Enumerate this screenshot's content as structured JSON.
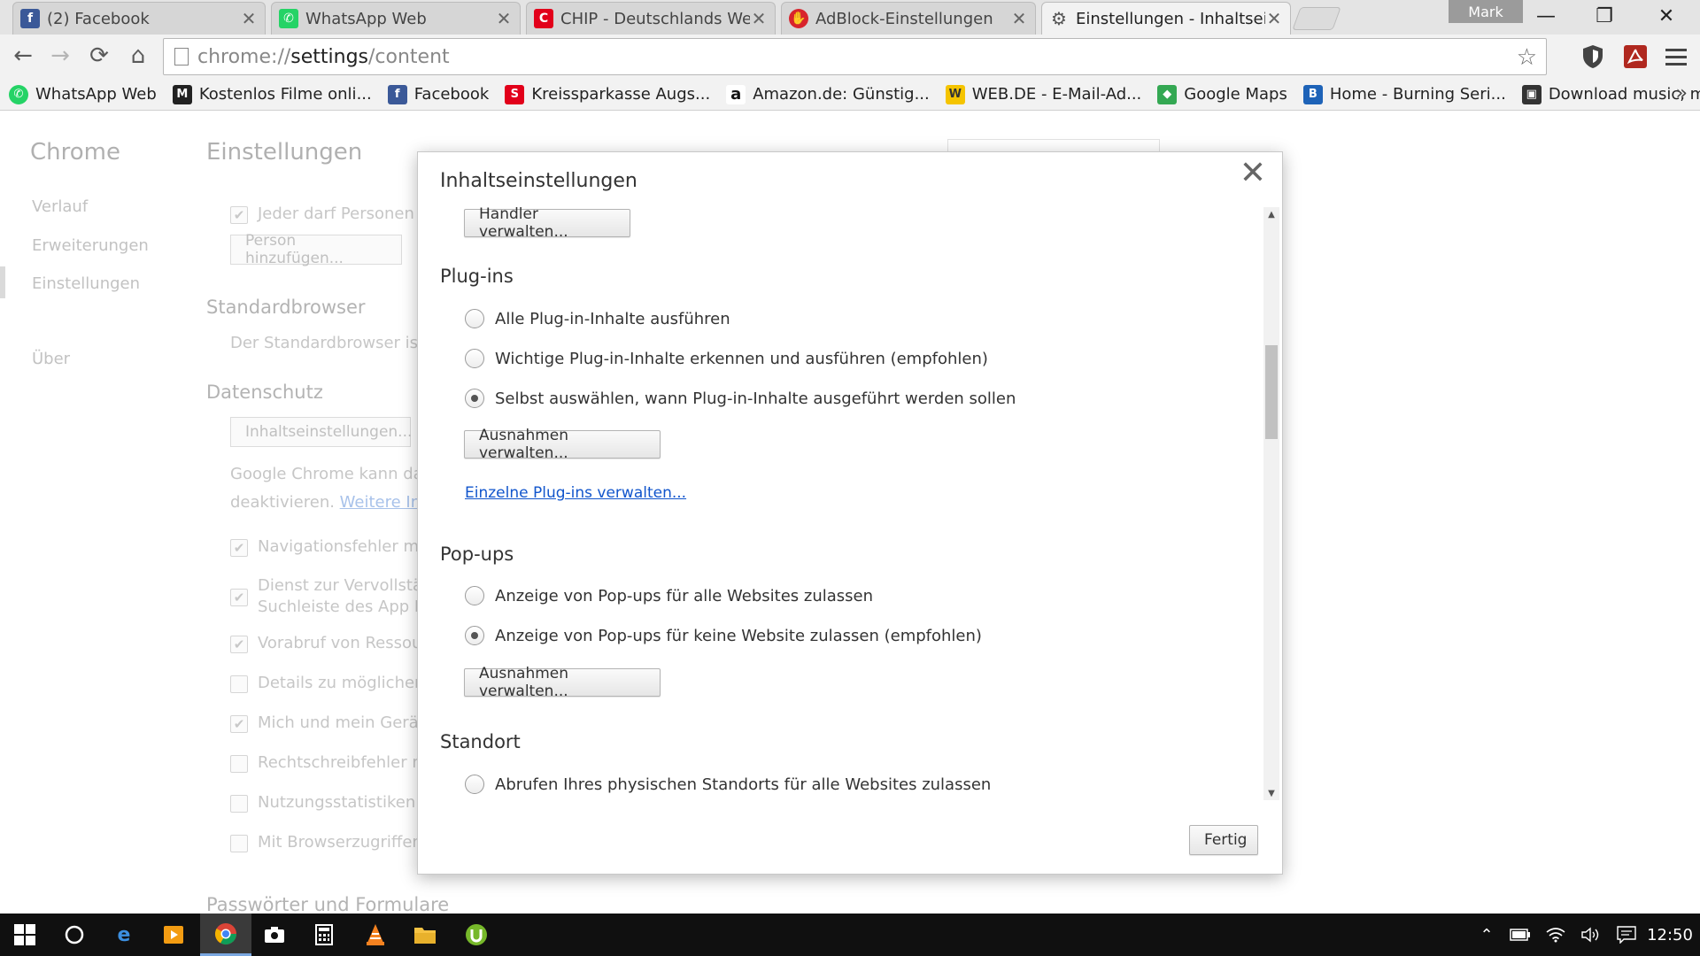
{
  "tabs": [
    {
      "title": "(2) Facebook",
      "icon": "facebook-icon",
      "color": "#3b5998",
      "glyph": "f"
    },
    {
      "title": "WhatsApp Web",
      "icon": "whatsapp-icon",
      "color": "#25d366",
      "glyph": "✆"
    },
    {
      "title": "CHIP - Deutschlands Webs",
      "icon": "chip-icon",
      "color": "#e2001a",
      "glyph": "C"
    },
    {
      "title": "AdBlock-Einstellungen",
      "icon": "adblock-icon",
      "color": "#d8242c",
      "glyph": "✋"
    },
    {
      "title": "Einstellungen - Inhaltseins",
      "icon": "gear-icon",
      "color": "#666666",
      "glyph": "⚙"
    }
  ],
  "profile": "Mark",
  "window_controls": {
    "minimize": "—",
    "restore": "❐",
    "close": "✕"
  },
  "toolbar": {
    "back": "←",
    "forward": "→",
    "reload": "⟳",
    "home": "⌂",
    "url_scheme": "chrome://",
    "url_host": "settings",
    "url_path": "/content",
    "star": "☆"
  },
  "bookmarks": [
    {
      "label": "WhatsApp Web",
      "icon": "whatsapp-icon",
      "color": "#25d366",
      "glyph": "✆"
    },
    {
      "label": "Kostenlos Filme onli...",
      "icon": "m-icon",
      "color": "#222222",
      "glyph": "M"
    },
    {
      "label": "Facebook",
      "icon": "facebook-icon",
      "color": "#3b5998",
      "glyph": "f"
    },
    {
      "label": "Kreissparkasse Augs...",
      "icon": "sparkasse-icon",
      "color": "#e2001a",
      "glyph": "S"
    },
    {
      "label": "Amazon.de: Günstig...",
      "icon": "amazon-icon",
      "color": "#ffffff",
      "glyph": "a"
    },
    {
      "label": "WEB.DE - E-Mail-Ad...",
      "icon": "webde-icon",
      "color": "#f5c400",
      "glyph": "W"
    },
    {
      "label": "Google Maps",
      "icon": "maps-icon",
      "color": "#34a853",
      "glyph": "◆"
    },
    {
      "label": "Home - Burning Seri...",
      "icon": "bs-icon",
      "color": "#1e63b8",
      "glyph": "B"
    },
    {
      "label": "Download music, m...",
      "icon": "download-icon",
      "color": "#333333",
      "glyph": "▣"
    }
  ],
  "bookmarks_more": "»",
  "settings": {
    "brand": "Chrome",
    "nav": [
      "Verlauf",
      "Erweiterungen",
      "Einstellungen",
      "Über"
    ],
    "title": "Einstellungen",
    "people_checkbox": "Jeder darf Personen zu",
    "add_person_button": "Person hinzufügen...",
    "default_browser_head": "Standardbrowser",
    "default_browser_text": "Der Standardbrowser ist m",
    "privacy_head": "Datenschutz",
    "content_settings_button": "Inhaltseinstellungen...",
    "privacy_text_1": "Google Chrome kann das B",
    "privacy_text_2_prefix": "deaktivieren. ",
    "privacy_link": "Weitere Infor",
    "checkboxes": [
      {
        "label": "Navigationsfehler mith",
        "checked": true
      },
      {
        "label": "Dienst zur Vervollständ",
        "label2": "Suchleiste des App Lau",
        "checked": true
      },
      {
        "label": "Vorabruf von Ressourc",
        "checked": true
      },
      {
        "label": "Details zu möglichen s",
        "checked": false
      },
      {
        "label": "Mich und mein Gerät v",
        "checked": true
      },
      {
        "label": "Rechtschreibfehler mit",
        "checked": false
      },
      {
        "label": "Nutzungsstatistiken un",
        "checked": false
      },
      {
        "label": "Mit Browserzugriffen e",
        "checked": false
      }
    ],
    "passwords_head": "Passwörter und Formulare"
  },
  "dialog": {
    "title": "Inhaltseinstellungen",
    "close": "✕",
    "handler_button": "Handler verwalten...",
    "plugins": {
      "heading": "Plug-ins",
      "options": [
        {
          "label": "Alle Plug-in-Inhalte ausführen",
          "checked": false
        },
        {
          "label": "Wichtige Plug-in-Inhalte erkennen und ausführen (empfohlen)",
          "checked": false
        },
        {
          "label": "Selbst auswählen, wann Plug-in-Inhalte ausgeführt werden sollen",
          "checked": true
        }
      ],
      "exceptions_button": "Ausnahmen verwalten...",
      "manage_link": "Einzelne Plug-ins verwalten..."
    },
    "popups": {
      "heading": "Pop-ups",
      "options": [
        {
          "label": "Anzeige von Pop-ups für alle Websites zulassen",
          "checked": false
        },
        {
          "label": "Anzeige von Pop-ups für keine Website zulassen (empfohlen)",
          "checked": true
        }
      ],
      "exceptions_button": "Ausnahmen verwalten..."
    },
    "location": {
      "heading": "Standort",
      "options": [
        {
          "label": "Abrufen Ihres physischen Standorts für alle Websites zulassen",
          "checked": false
        }
      ]
    },
    "done_button": "Fertig"
  },
  "taskbar": {
    "clock": "12:50",
    "apps": [
      "windows-start-icon",
      "cortana-icon",
      "edge-icon",
      "media-player-icon",
      "chrome-icon",
      "camera-icon",
      "calculator-icon",
      "vlc-icon",
      "file-explorer-icon",
      "utorrent-icon"
    ]
  }
}
